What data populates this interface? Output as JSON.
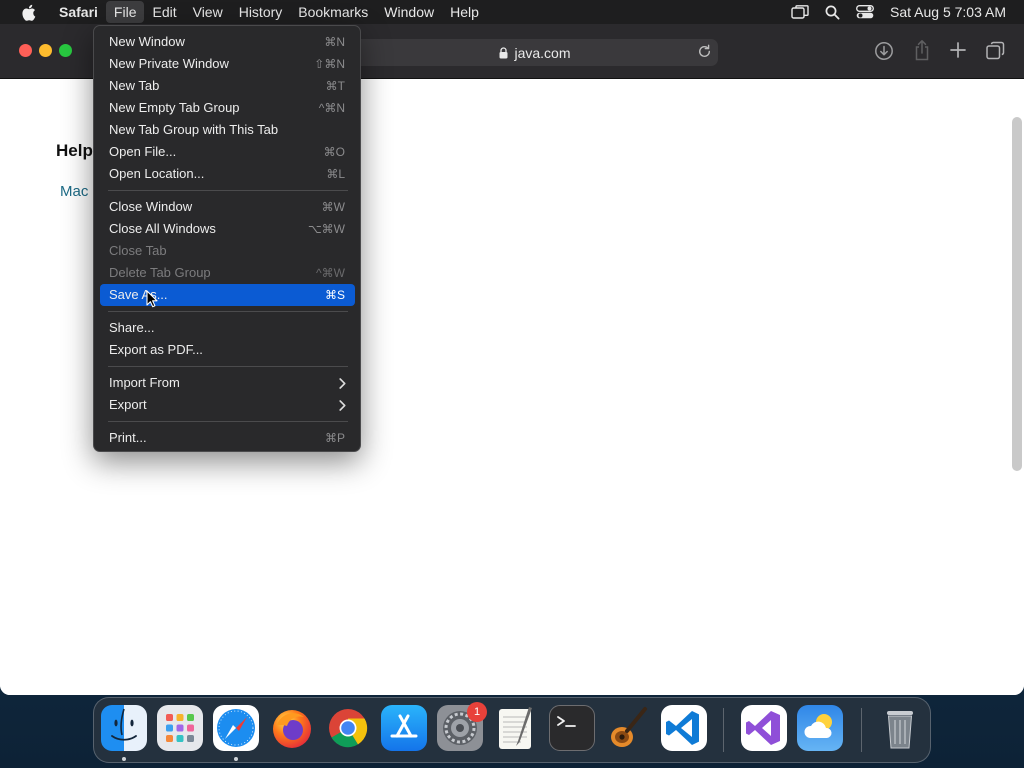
{
  "menubar": {
    "items": [
      "Safari",
      "File",
      "Edit",
      "View",
      "History",
      "Bookmarks",
      "Window",
      "Help"
    ],
    "clock": "Sat Aug 5  7:03 AM"
  },
  "browser": {
    "url": "java.com",
    "page_heading": "Help",
    "page_link": "Mac"
  },
  "file_menu": {
    "items": [
      {
        "label": "New Window",
        "shortcut": "⌘N",
        "state": "enabled"
      },
      {
        "label": "New Private Window",
        "shortcut": "⇧⌘N",
        "state": "enabled"
      },
      {
        "label": "New Tab",
        "shortcut": "⌘T",
        "state": "enabled"
      },
      {
        "label": "New Empty Tab Group",
        "shortcut": "^⌘N",
        "state": "enabled"
      },
      {
        "label": "New Tab Group with This Tab",
        "shortcut": "",
        "state": "enabled"
      },
      {
        "label": "Open File...",
        "shortcut": "⌘O",
        "state": "enabled"
      },
      {
        "label": "Open Location...",
        "shortcut": "⌘L",
        "state": "enabled"
      },
      {
        "label": "Close Window",
        "shortcut": "⌘W",
        "state": "enabled"
      },
      {
        "label": "Close All Windows",
        "shortcut": "⌥⌘W",
        "state": "enabled"
      },
      {
        "label": "Close Tab",
        "shortcut": "",
        "state": "disabled"
      },
      {
        "label": "Delete Tab Group",
        "shortcut": "^⌘W",
        "state": "disabled"
      },
      {
        "label": "Save As...",
        "shortcut": "⌘S",
        "state": "highlighted"
      },
      {
        "label": "Share...",
        "shortcut": "",
        "state": "enabled"
      },
      {
        "label": "Export as PDF...",
        "shortcut": "",
        "state": "enabled"
      },
      {
        "label": "Import From",
        "shortcut": "",
        "state": "submenu"
      },
      {
        "label": "Export",
        "shortcut": "",
        "state": "submenu"
      },
      {
        "label": "Print...",
        "shortcut": "⌘P",
        "state": "enabled"
      }
    ]
  },
  "dock": {
    "apps": [
      "Finder",
      "Launchpad",
      "Safari",
      "Firefox",
      "Google Chrome",
      "App Store",
      "System Settings",
      "TextEdit",
      "Terminal",
      "GarageBand",
      "Visual Studio Code",
      "Visual Studio",
      "Weather",
      "Trash"
    ],
    "settings_badge": "1"
  },
  "colors": {
    "menu_highlight": "#0b5bd3",
    "link": "#1d6b86",
    "badge": "#e8413a"
  }
}
